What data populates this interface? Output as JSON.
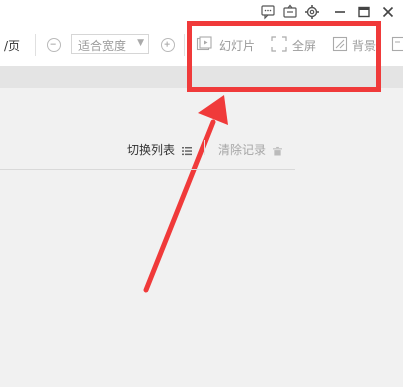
{
  "toolbar": {
    "page_suffix": "/页",
    "zoom_value": "适合宽度",
    "slideshow_label": "幻灯片",
    "fullscreen_label": "全屏",
    "background_label": "背景"
  },
  "panel": {
    "switch_list_label": "切换列表",
    "clear_records_label": "清除记录"
  },
  "colors": {
    "highlight": "#f03a3a",
    "toolbar_bg": "#ffffff",
    "page_bg": "#f1f1f1"
  },
  "icons": [
    "feedback-icon",
    "skin-icon",
    "settings-icon",
    "minimize-icon",
    "maximize-icon",
    "close-icon",
    "zoom-out-icon",
    "zoom-in-icon",
    "slideshow-icon",
    "fullscreen-icon",
    "background-icon",
    "list-icon",
    "trash-icon"
  ]
}
